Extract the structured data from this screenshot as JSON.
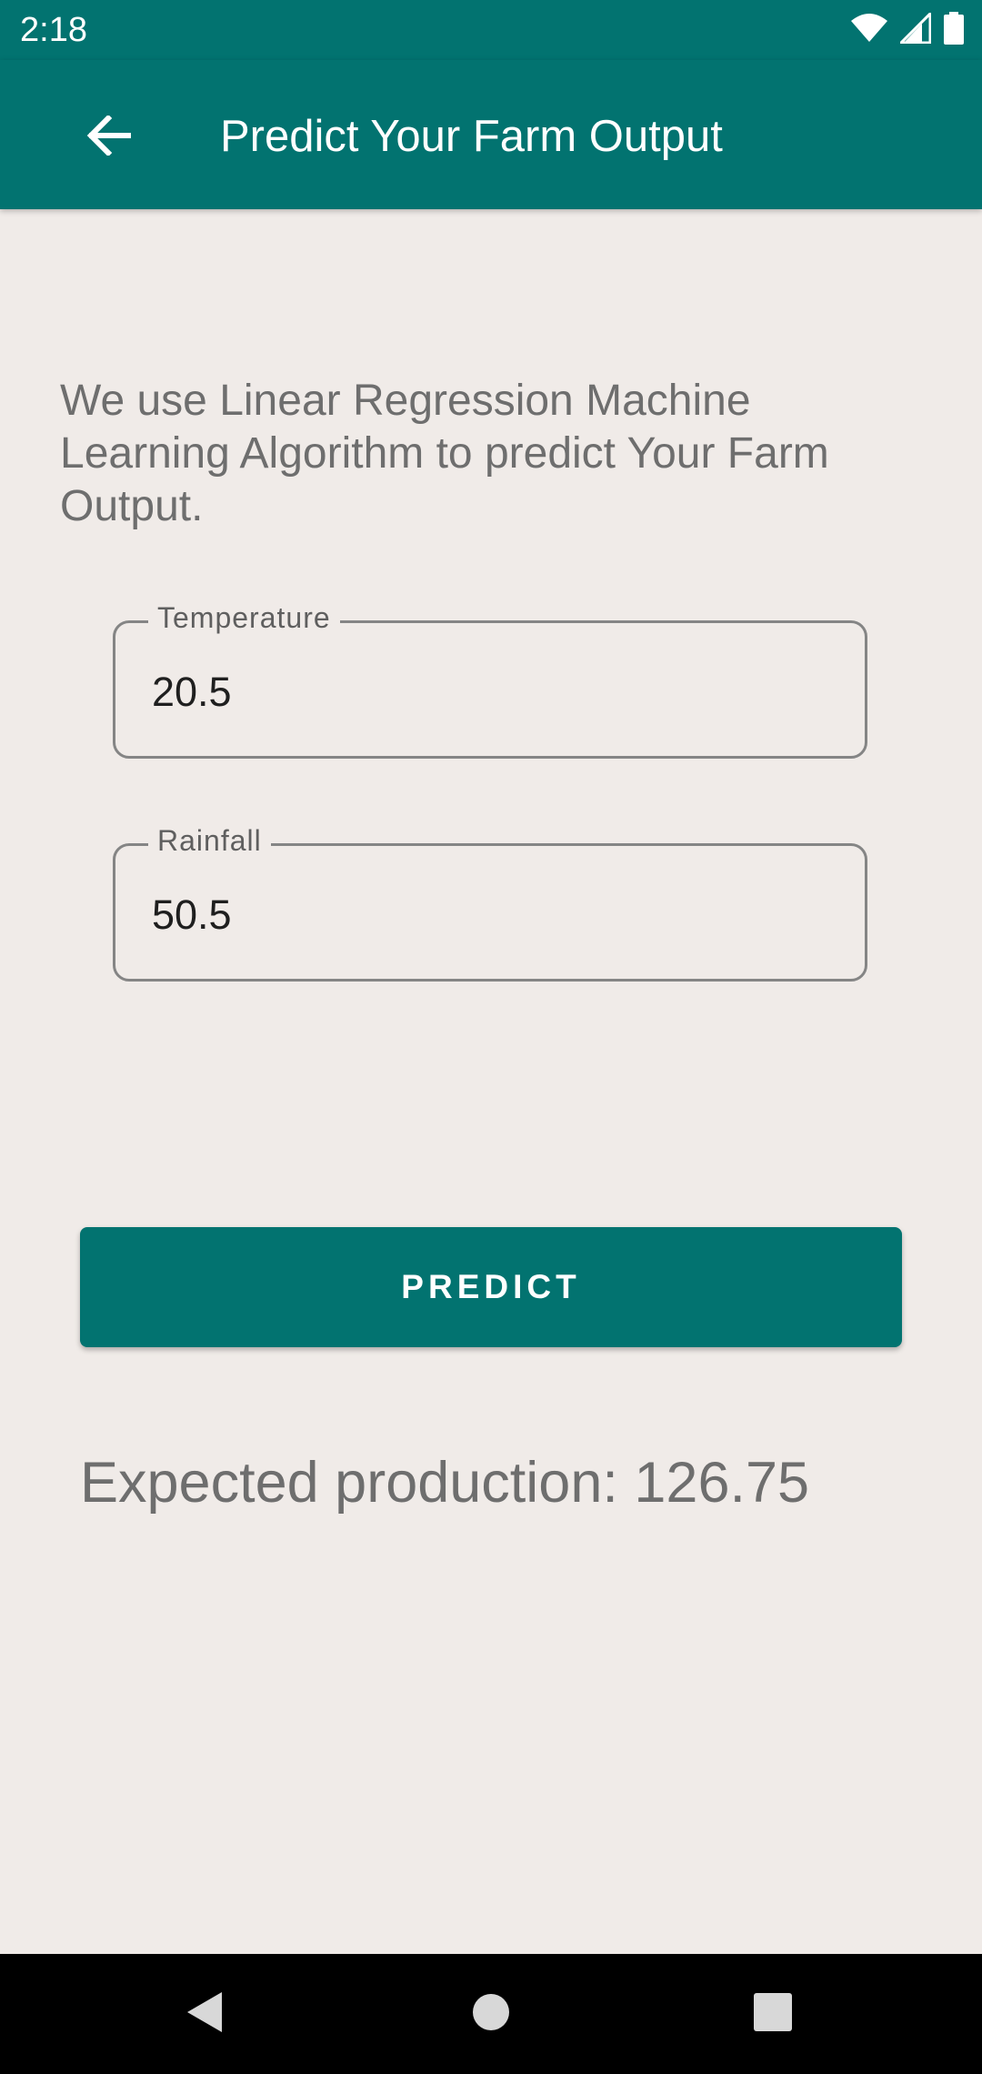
{
  "status_bar": {
    "time": "2:18",
    "icons": [
      "wifi-icon",
      "cellular-signal-icon",
      "battery-icon"
    ]
  },
  "app_bar": {
    "back_icon": "arrow-back-icon",
    "title": "Predict Your Farm Output"
  },
  "main": {
    "description": "We use Linear Regression Machine Learning Algorithm to predict Your Farm Output.",
    "fields": [
      {
        "label": "Temperature",
        "value": "20.5"
      },
      {
        "label": "Rainfall",
        "value": "50.5"
      }
    ],
    "predict_label": "PREDICT",
    "result": "Expected production: 126.75"
  },
  "nav_bar": {
    "icons": [
      "nav-back-icon",
      "nav-home-icon",
      "nav-recents-icon"
    ]
  },
  "colors": {
    "primary": "#027370",
    "background": "#F0EBE8",
    "text_secondary": "#6E6E6E",
    "on_primary": "#FFFFFF"
  }
}
